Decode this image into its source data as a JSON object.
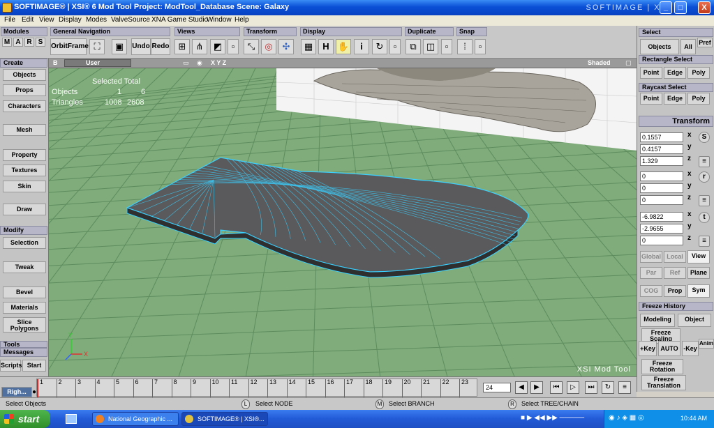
{
  "window": {
    "title": "SOFTIMAGE® | XSI® 6 Mod Tool Project: ModTool_Database    Scene: Galaxy",
    "brand": "SOFTIMAGE | XSI",
    "min": "_",
    "max": "□",
    "close": "X"
  },
  "menu": [
    "File",
    "Edit",
    "View",
    "Display",
    "Modes",
    "ValveSource",
    "XNA Game Studio",
    "Window",
    "Help"
  ],
  "toolbar": {
    "modules": "Modules",
    "module_keys": [
      "M",
      "A",
      "R",
      "S"
    ],
    "general_nav": "General Navigation",
    "orbit_frame": "OrbitFrame",
    "undo": "Undo",
    "redo": "Redo",
    "views": "Views",
    "transform": "Transform",
    "display": "Display",
    "duplicate": "Duplicate",
    "snap": "Snap",
    "display_h": "H",
    "display_i": "i"
  },
  "left": {
    "create": "Create",
    "objects": "Objects",
    "props": "Props",
    "characters": "Characters",
    "mesh": "Mesh",
    "property": "Property",
    "textures": "Textures",
    "skin": "Skin",
    "draw": "Draw",
    "modify": "Modify",
    "selection": "Selection",
    "tweak": "Tweak",
    "bevel": "Bevel",
    "materials": "Materials",
    "slice": "Slice",
    "polygons": "Polygons",
    "tools": "Tools",
    "messages": "Messages",
    "scripts": "Scripts",
    "start": "Start"
  },
  "viewport": {
    "letter": "B",
    "camera": "User",
    "xyz": "X Y Z",
    "shading": "Shaded",
    "stats_header": "Selected Total",
    "objects_label": "Objects",
    "objects_selected": "1",
    "objects_total": "6",
    "triangles_label": "Triangles",
    "triangles_selected": "1008",
    "triangles_total": "2608",
    "watermark": "XSI Mod Tool"
  },
  "right": {
    "select": "Select",
    "objects": "Objects",
    "all": "All",
    "pref": "Pref",
    "rect_select": "Rectangle Select",
    "raycast_select": "Raycast Select",
    "point": "Point",
    "edge": "Edge",
    "poly": "Poly",
    "transform": "Transform",
    "scale": [
      "0.1557",
      "0.4157",
      "1.329"
    ],
    "rotate": [
      "0",
      "0",
      "0"
    ],
    "translate": [
      "-6.9822",
      "-2.9655",
      "0"
    ],
    "axes": [
      "x",
      "y",
      "z"
    ],
    "icon_s": "S",
    "icon_r": "r",
    "icon_t": "t",
    "global": "Global",
    "local": "Local",
    "view": "View",
    "par": "Par",
    "ref": "Ref",
    "plane": "Plane",
    "cog": "COG",
    "prop": "Prop",
    "sym": "Sym",
    "freeze_history": "Freeze History",
    "modeling": "Modeling",
    "object": "Object",
    "freeze_scaling_1": "Freeze",
    "freeze_scaling_2": "Scaling",
    "key_add": "+Key",
    "auto": "AUTO",
    "key_remove": "-Key",
    "anim": "Anim",
    "freeze_rotation_1": "Freeze",
    "freeze_rotation_2": "Rotation",
    "freeze_translation_1": "Freeze",
    "freeze_translation_2": "Translation"
  },
  "timeline": {
    "ticks": [
      "1",
      "2",
      "3",
      "4",
      "5",
      "6",
      "7",
      "8",
      "9",
      "10",
      "11",
      "12",
      "13",
      "14",
      "15",
      "16",
      "17",
      "18",
      "19",
      "20",
      "21",
      "22",
      "23"
    ],
    "current_frame": "24",
    "panel_tab": "Righ..."
  },
  "status": {
    "left": "Select Objects",
    "l_btn": "L",
    "l_text": "Select NODE",
    "m_btn": "M",
    "m_text": "Select BRANCH",
    "r_btn": "R",
    "r_text": "Select TREE/CHAIN"
  },
  "taskbar": {
    "start": "start",
    "task1": "National Geographic ...",
    "task2": "SOFTIMAGE® | XSI®...",
    "clock": "10:44 AM"
  },
  "colors": {
    "viewport_ground": "#7fac7a",
    "grid_line": "#5f8c5e",
    "wire_select": "#3ad0ff"
  }
}
